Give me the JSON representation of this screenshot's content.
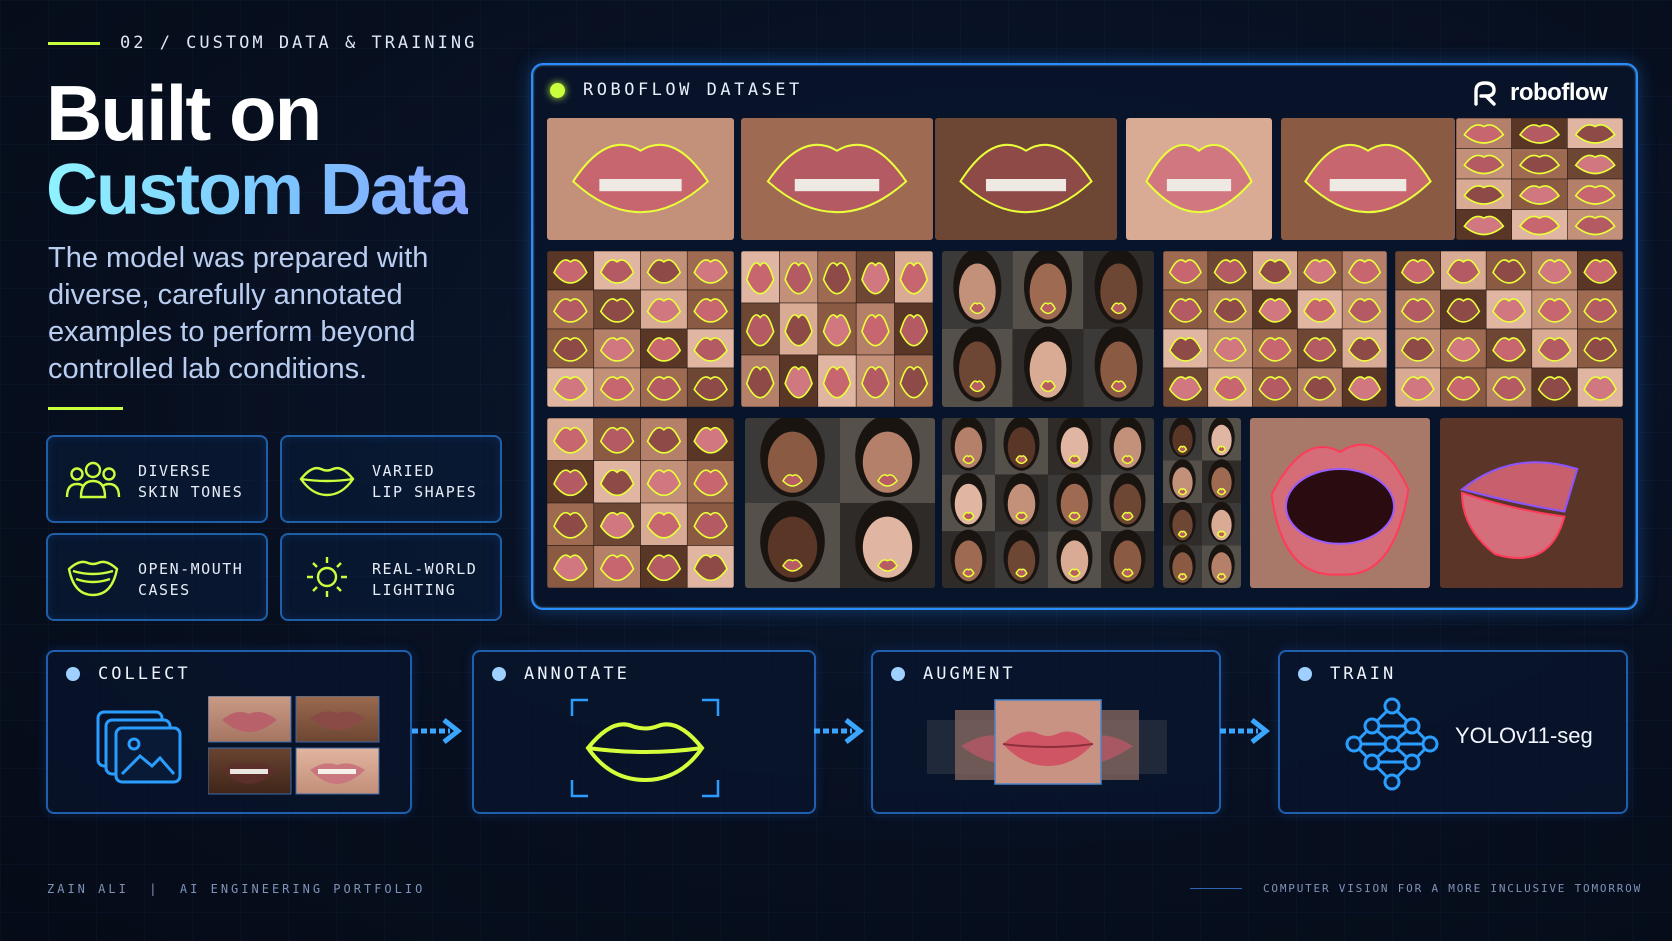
{
  "header": {
    "kicker": "02 / CUSTOM DATA & TRAINING",
    "title_line1": "Built on",
    "title_line2": "Custom Data",
    "description": "The model was prepared with diverse, carefully annotated examples to perform beyond controlled lab conditions."
  },
  "features": [
    {
      "line1": "DIVERSE",
      "line2": "SKIN TONES",
      "icon": "people-group-icon"
    },
    {
      "line1": "VARIED",
      "line2": "LIP SHAPES",
      "icon": "lips-icon"
    },
    {
      "line1": "OPEN-MOUTH",
      "line2": "CASES",
      "icon": "open-mouth-icon"
    },
    {
      "line1": "REAL-WORLD",
      "line2": "LIGHTING",
      "icon": "sun-icon"
    }
  ],
  "dataset_panel": {
    "title": "ROBOFLOW DATASET",
    "brand": "roboflow"
  },
  "pipeline": {
    "steps": [
      {
        "label": "COLLECT",
        "icon": "image-stack-icon"
      },
      {
        "label": "ANNOTATE",
        "icon": "lips-outline-icon"
      },
      {
        "label": "AUGMENT",
        "icon": "augment-preview"
      },
      {
        "label": "TRAIN",
        "icon": "neural-network-icon",
        "model": "YOLOv11-seg"
      }
    ]
  },
  "footer": {
    "left": "ZAIN ALI  |  AI ENGINEERING PORTFOLIO",
    "right": "COMPUTER VISION FOR A MORE INCLUSIVE TOMORROW"
  },
  "colors": {
    "accent_lime": "#c9ff3d",
    "accent_blue": "#2a8dff",
    "background": "#070f1f"
  }
}
